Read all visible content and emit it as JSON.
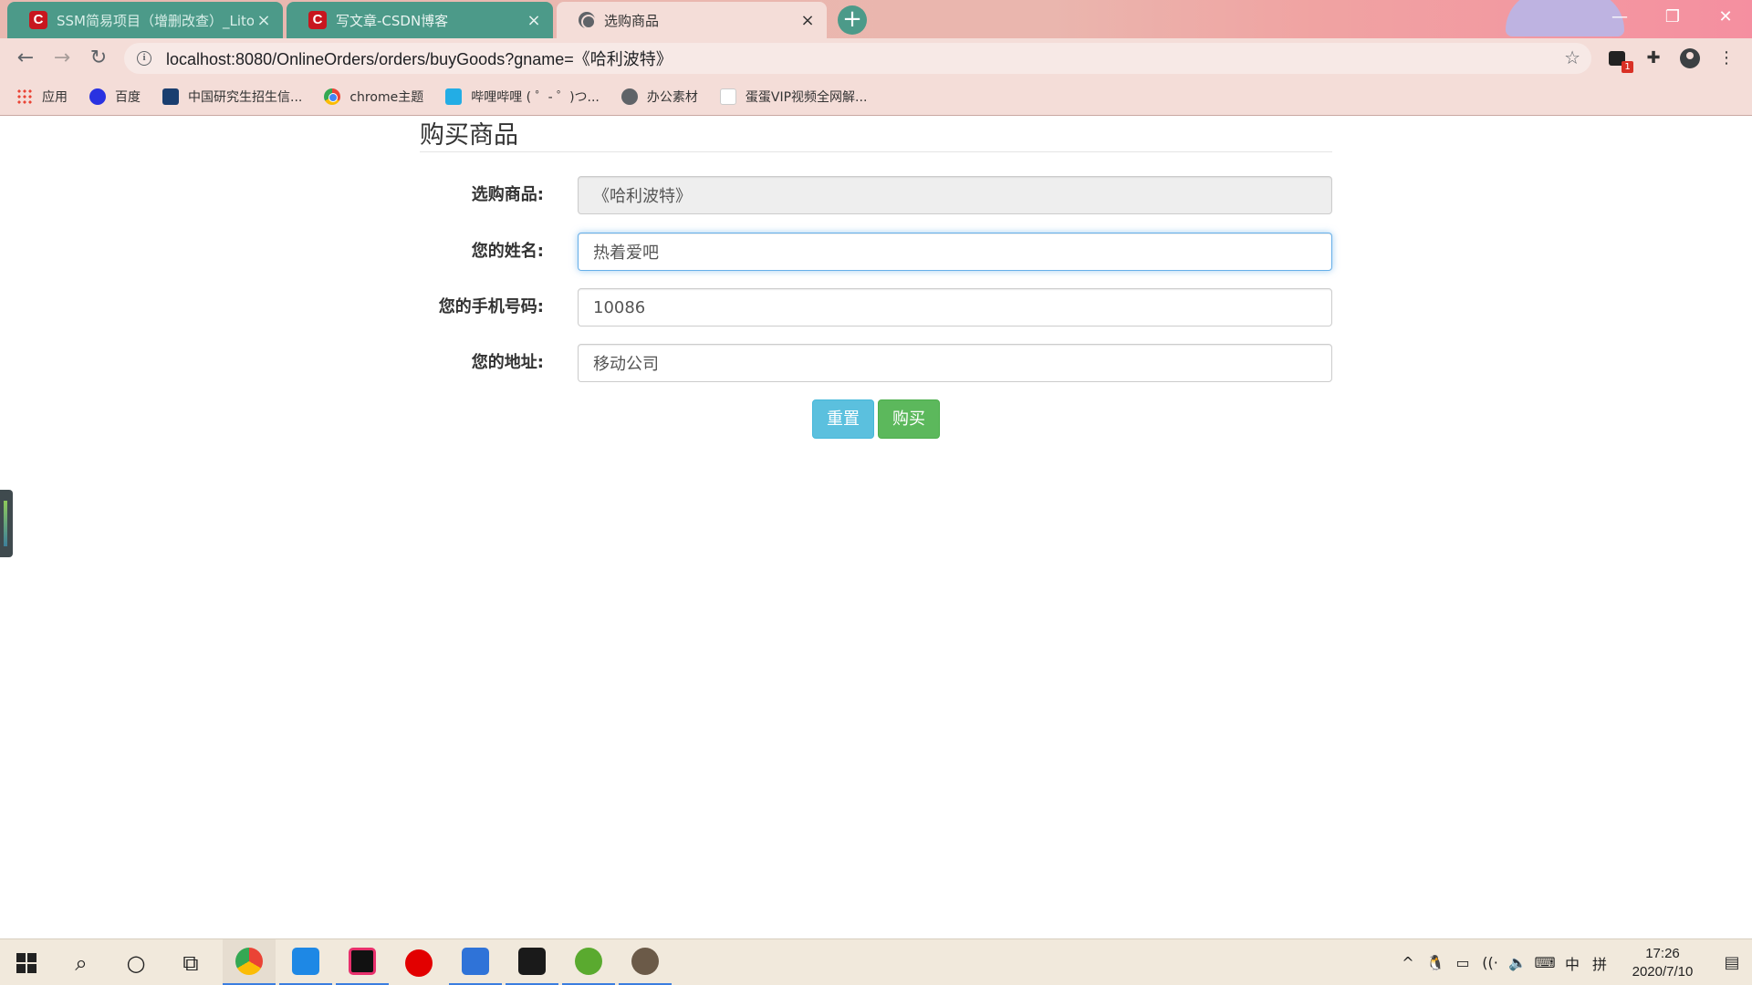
{
  "browser": {
    "tabs": [
      {
        "title": "SSM简易项目（增删改查）_Lito",
        "icon": "csdn-icon"
      },
      {
        "title": "写文章-CSDN博客",
        "icon": "csdn-icon"
      },
      {
        "title": "选购商品",
        "icon": "globe-icon"
      }
    ],
    "tab_close": "×",
    "new_tab": "+",
    "window_controls": {
      "minimize": "—",
      "restore": "❐",
      "close": "✕"
    },
    "nav": {
      "back": "←",
      "forward": "→",
      "reload": "↻"
    },
    "address": {
      "info": "i",
      "url": "localhost:8080/OnlineOrders/orders/buyGoods?gname=《哈利波特》",
      "star": "☆"
    },
    "extensions": {
      "ext_badge": "1",
      "puzzle": "✚",
      "menu": "⋮"
    },
    "bookmarks": [
      {
        "label": "应用",
        "icon": "apps-icon"
      },
      {
        "label": "百度",
        "icon": "baidu-icon"
      },
      {
        "label": "中国研究生招生信...",
        "icon": "graduation-icon"
      },
      {
        "label": "chrome主题",
        "icon": "chrome-icon"
      },
      {
        "label": "哔哩哔哩 ( ゜- ゜)つ...",
        "icon": "bilibili-icon"
      },
      {
        "label": "办公素材",
        "icon": "globe-icon"
      },
      {
        "label": "蛋蛋VIP视频全网解...",
        "icon": "vip-icon"
      }
    ]
  },
  "form": {
    "legend": "购买商品",
    "fields": [
      {
        "label": "选购商品:",
        "value": "《哈利波特》",
        "readonly": true
      },
      {
        "label": "您的姓名:",
        "value": "热着爱吧",
        "focused": true
      },
      {
        "label": "您的手机号码:",
        "value": "10086"
      },
      {
        "label": "您的地址:",
        "value": "移动公司"
      }
    ],
    "reset_label": "重置",
    "buy_label": "购买",
    "colors": {
      "reset": "#5bc0de",
      "buy": "#5cb85c",
      "focus": "#66afe9"
    }
  },
  "taskbar": {
    "search": "⌕",
    "cortana": "○",
    "taskview": "⧉",
    "tray": {
      "chevron": "^",
      "penguin": "🐧",
      "battery": "▭",
      "wifi": "((·",
      "volume": "🔈",
      "keyboard": "⌨",
      "ime": "中",
      "ime_mode": "拼"
    },
    "time": "17:26",
    "date": "2020/7/10",
    "notifications": "▤"
  }
}
